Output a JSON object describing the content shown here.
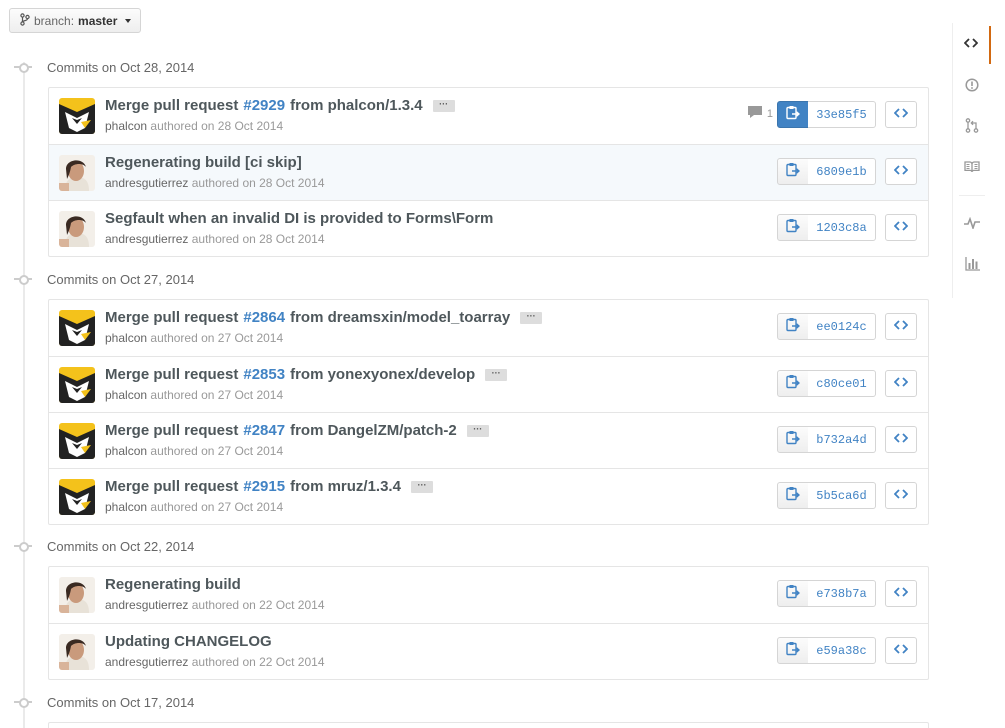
{
  "branch": {
    "label": "branch:",
    "value": "master"
  },
  "groups": [
    {
      "title": "Commits on Oct 28, 2014",
      "commits": [
        {
          "prefix": "Merge pull request",
          "pr": "#2929",
          "suffix": "from phalcon/1.3.4",
          "ellipsis": true,
          "author": "phalcon",
          "authored": "authored on 28 Oct 2014",
          "sha": "33e85f5",
          "comments": "1",
          "avatar": "phalcon",
          "copy_active": true
        },
        {
          "prefix": "Regenerating build [ci skip]",
          "pr": "",
          "suffix": "",
          "ellipsis": false,
          "author": "andresgutierrez",
          "authored": "authored on 28 Oct 2014",
          "sha": "6809e1b",
          "comments": "",
          "avatar": "person",
          "highlight": true
        },
        {
          "prefix": "Segfault when an invalid DI is provided to Forms\\Form",
          "pr": "",
          "suffix": "",
          "ellipsis": false,
          "author": "andresgutierrez",
          "authored": "authored on 28 Oct 2014",
          "sha": "1203c8a",
          "comments": "",
          "avatar": "person"
        }
      ]
    },
    {
      "title": "Commits on Oct 27, 2014",
      "commits": [
        {
          "prefix": "Merge pull request",
          "pr": "#2864",
          "suffix": "from dreamsxin/model_toarray",
          "ellipsis": true,
          "author": "phalcon",
          "authored": "authored on 27 Oct 2014",
          "sha": "ee0124c",
          "comments": "",
          "avatar": "phalcon"
        },
        {
          "prefix": "Merge pull request",
          "pr": "#2853",
          "suffix": "from yonexyonex/develop",
          "ellipsis": true,
          "author": "phalcon",
          "authored": "authored on 27 Oct 2014",
          "sha": "c80ce01",
          "comments": "",
          "avatar": "phalcon"
        },
        {
          "prefix": "Merge pull request",
          "pr": "#2847",
          "suffix": "from DangelZM/patch-2",
          "ellipsis": true,
          "author": "phalcon",
          "authored": "authored on 27 Oct 2014",
          "sha": "b732a4d",
          "comments": "",
          "avatar": "phalcon"
        },
        {
          "prefix": "Merge pull request",
          "pr": "#2915",
          "suffix": "from mruz/1.3.4",
          "ellipsis": true,
          "author": "phalcon",
          "authored": "authored on 27 Oct 2014",
          "sha": "5b5ca6d",
          "comments": "",
          "avatar": "phalcon"
        }
      ]
    },
    {
      "title": "Commits on Oct 22, 2014",
      "commits": [
        {
          "prefix": "Regenerating build",
          "pr": "",
          "suffix": "",
          "ellipsis": false,
          "author": "andresgutierrez",
          "authored": "authored on 22 Oct 2014",
          "sha": "e738b7a",
          "comments": "",
          "avatar": "person"
        },
        {
          "prefix": "Updating CHANGELOG",
          "pr": "",
          "suffix": "",
          "ellipsis": false,
          "author": "andresgutierrez",
          "authored": "authored on 22 Oct 2014",
          "sha": "e59a38c",
          "comments": "",
          "avatar": "person"
        }
      ]
    },
    {
      "title": "Commits on Oct 17, 2014",
      "commits": []
    }
  ],
  "repo_nav": [
    {
      "icon": "code-icon",
      "selected": true
    },
    {
      "icon": "issue-icon"
    },
    {
      "icon": "pull-request-icon"
    },
    {
      "icon": "wiki-icon"
    },
    {
      "icon": "pulse-icon"
    },
    {
      "icon": "graphs-icon"
    }
  ],
  "colors": {
    "link": "#4183c4",
    "accent": "#d26911",
    "copy_active": "#4183c4"
  }
}
